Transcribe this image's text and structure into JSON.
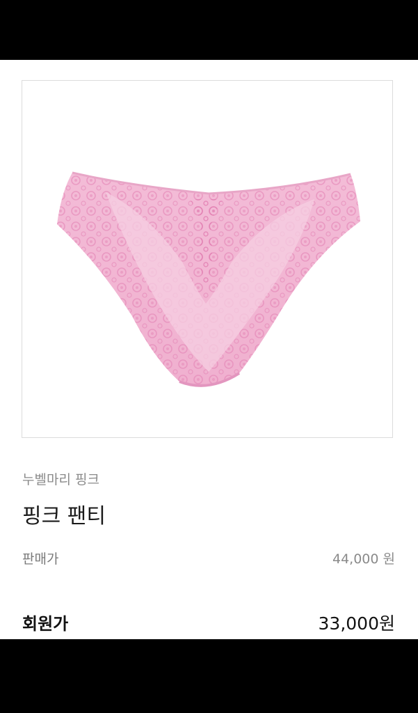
{
  "product": {
    "image_icon": "pink-lace-panty-image",
    "brand": "누벨마리 핑크",
    "name": "핑크 팬티",
    "regular_price_label": "판매가",
    "regular_price": "44,000 원",
    "member_price_label": "회원가",
    "member_price": "33,000원"
  },
  "colors": {
    "top_bar": "#000000",
    "bottom_bar": "#000000",
    "background": "#ffffff",
    "product_pink": "#f2b8d4",
    "lace_pink": "#e695bd"
  }
}
